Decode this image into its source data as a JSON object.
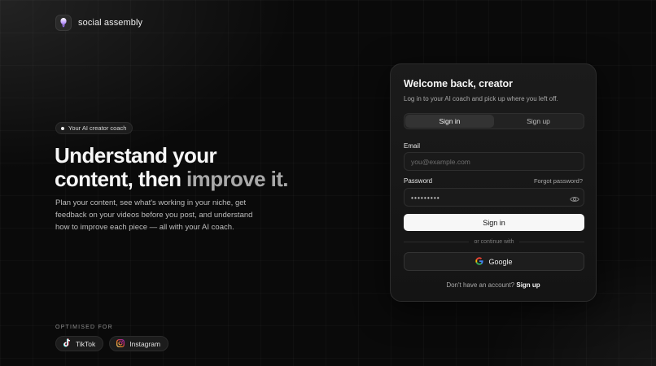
{
  "brand": {
    "name": "social assembly"
  },
  "hero": {
    "badge": "Your AI creator coach",
    "title_line1": "Understand your",
    "title_line2_a": "content, then ",
    "title_line2_b": "improve it.",
    "description": "Plan your content, see what's working in your niche, get feedback on your videos before you post, and understand how to improve each piece — all with your AI coach."
  },
  "platforms": {
    "label": "OPTIMISED FOR",
    "items": [
      {
        "label": "TikTok",
        "icon": "tiktok-icon"
      },
      {
        "label": "Instagram",
        "icon": "instagram-icon"
      }
    ]
  },
  "login": {
    "title": "Welcome back, creator",
    "subtitle": "Log in to your AI coach and pick up where you left off.",
    "tabs": [
      {
        "label": "Sign in",
        "active": true
      },
      {
        "label": "Sign up",
        "active": false
      }
    ],
    "email": {
      "label": "Email",
      "placeholder": "you@example.com",
      "value": ""
    },
    "password": {
      "label": "Password",
      "forgot": "Forgot password?",
      "value": "•••••••••"
    },
    "submit": "Sign in",
    "divider": "or continue with",
    "google": "Google",
    "signup_prompt": "Don't have an account?",
    "signup_link": "Sign up"
  },
  "colors": {
    "accent": "#f7f7f7",
    "background": "#0a0a0a",
    "logo_glow": "#a97bff"
  }
}
